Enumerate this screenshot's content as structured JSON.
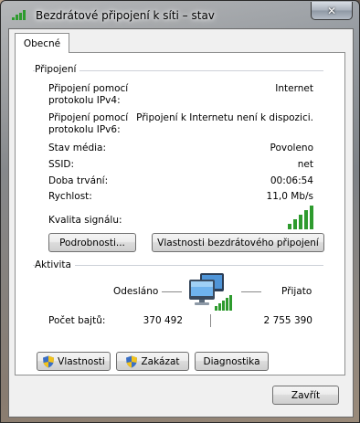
{
  "window": {
    "title": "Bezdrátové připojení k síti – stav",
    "close_glyph": "✕"
  },
  "tabs": [
    {
      "label": "Obecné"
    }
  ],
  "connection": {
    "group_label": "Připojení",
    "rows": [
      {
        "label": "Připojení pomocí\nprotokolu IPv4:",
        "value": "Internet"
      },
      {
        "label": "Připojení pomocí\nprotokolu IPv6:",
        "value": "Připojení k Internetu není k dispozici."
      },
      {
        "label": "Stav média:",
        "value": "Povoleno"
      },
      {
        "label": "SSID:",
        "value": "net"
      },
      {
        "label": "Doba trvání:",
        "value": "00:06:54"
      },
      {
        "label": "Rychlost:",
        "value": "11,0 Mb/s"
      }
    ],
    "signal_label": "Kvalita signálu:",
    "signal_level": 5,
    "signal_max": 5,
    "details_button": "Podrobnosti...",
    "wireless_props_button": "Vlastnosti bezdrátového připojení"
  },
  "activity": {
    "group_label": "Aktivita",
    "sent_label": "Odesláno",
    "received_label": "Přijato",
    "bytes_label": "Počet bajtů:",
    "bytes_sent": "370 492",
    "bytes_received": "2 755 390"
  },
  "actions": {
    "properties_button": "Vlastnosti",
    "disable_button": "Zakázat",
    "diagnose_button": "Diagnostika"
  },
  "footer": {
    "close_button": "Zavřít"
  },
  "colors": {
    "signal_green": "#2e9b2e",
    "shield_blue": "#3a6fc4",
    "shield_yellow": "#f2c21b"
  }
}
